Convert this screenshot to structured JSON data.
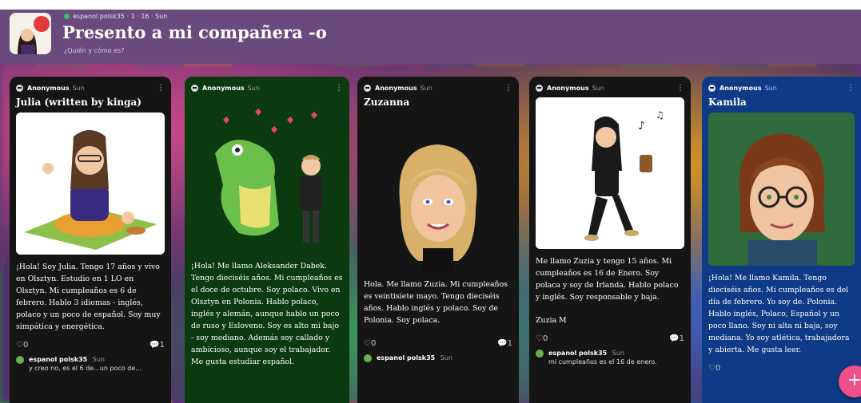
{
  "header": {
    "breadcrumb": "espanol polsk35 · 1 · 16 · Sun",
    "title": "Presento a mi compañera -o",
    "subtitle": "¿Quién y cómo es?"
  },
  "columns": [
    {
      "author": "Anonymous",
      "time": "Sun",
      "title": "Julia (written by kinga)",
      "body": "¡Hola! Soy Julia. Tengo 17 años y vivo en Olsztyn. Estudio en 1 LO en Olsztyn. Mi cumpleaños es 6 de febrero. Hablo 3 idiomas - inglés, polaco y un poco de español. Soy muy simpática y energética.",
      "likes": "0",
      "comments": "1",
      "comment_author": "espanol polsk35",
      "comment_time": "Sun",
      "comment_text": "y creo no, es el 6 de.. un poco de..."
    },
    {
      "author": "Anonymous",
      "time": "Sun",
      "title": "",
      "body": "¡Hola! Me llamo Aleksander Dabek. Tengo dieciséis años. Mi cumpleaños es el doce de octubre. Soy polaco. Vivo en Olsztyn en Polonia. Hablo polaco, inglés y alemán, aunque hablo un poco de ruso y Esloveno. Soy es alto mi bajo - soy mediano. Además soy callado y ambicioso, aunque soy el trabajador. Me gusta estudiar español.",
      "likes": "",
      "comments": ""
    },
    {
      "author": "Anonymous",
      "time": "Sun",
      "title": "Zuzanna",
      "body": "Hola. Me llamo Zuzia. Mi cumpleaños es veintisiete mayo. Tengo dieciséis años. Hablo inglés y polaco. Soy de Polonia. Soy polaca.",
      "likes": "0",
      "comments": "1",
      "comment_author": "espanol polsk35",
      "comment_time": "Sun",
      "comment_text": ""
    },
    {
      "author": "Anonymous",
      "time": "Sun",
      "title": "",
      "body": "Me llamo Zuzia y tengo 15 años. Mi cumpleaños es 16 de Enero. Soy polaca y soy de Irlanda. Hablo polaco y inglés. Soy responsable y baja.",
      "signature": "Zuzia M",
      "likes": "0",
      "comments": "1",
      "comment_author": "espanol polsk35",
      "comment_time": "Sun",
      "comment_text": "mi cumpleaños es el 16 de enero."
    },
    {
      "author": "Anonymous",
      "time": "Sun",
      "title": "Kamila",
      "body": "¡Hola! Me llamo Kamila. Tengo dieciséis años. Mi cumpleaños es del día de febrero. Yo soy de. Polonia. Hablo inglés, Polaco, Español y un poco llano. Soy ni alta ni baja, soy mediana. Yo soy atlética, trabajadora y abierta. Me gusta leer.",
      "likes": "0",
      "comments": ""
    }
  ],
  "fab": {
    "label": "+"
  },
  "colors": {
    "header": "#6a4a7d",
    "dark_card": "#151515",
    "green_card": "#0c3a10",
    "blue_card": "#0e3a86",
    "fab": "#f0508a"
  },
  "icons": [
    "anonymous-avatar-icon",
    "heart-icon",
    "comment-icon",
    "kebab-menu-icon",
    "plus-icon"
  ]
}
